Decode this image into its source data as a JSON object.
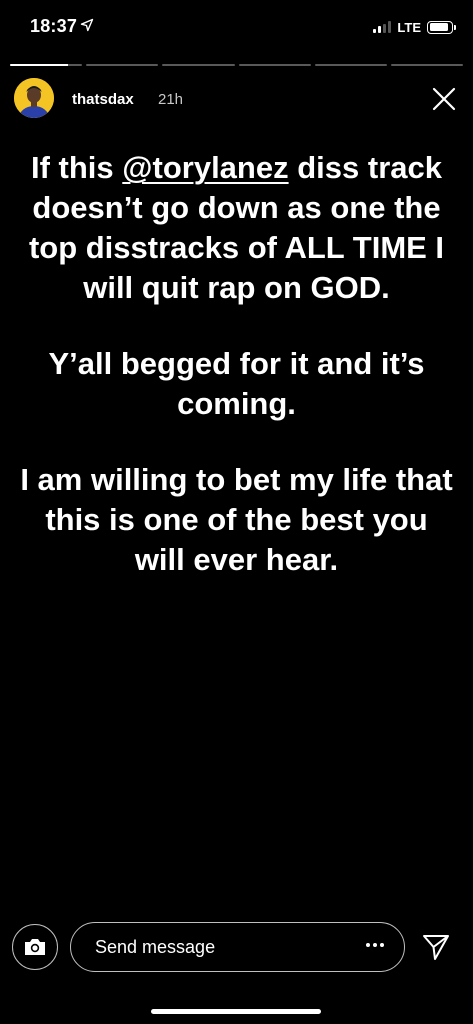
{
  "status_bar": {
    "time": "18:37",
    "network": "LTE",
    "signal_bars_active": 2,
    "signal_bars_total": 4,
    "battery_level": 0.9
  },
  "story": {
    "segments_total": 6,
    "current_segment": 1,
    "current_segment_progress": 0.8,
    "username": "thatsdax",
    "timestamp": "21h",
    "text": {
      "p1_before": "If this ",
      "p1_mention": "@torylanez",
      "p1_after": " diss track doesn’t go down as one the top disstracks of ALL TIME I will quit rap on GOD.",
      "p2": "Y’all begged for it and it’s coming.",
      "p3": "I am willing to bet my life that this is one of the best you will ever hear."
    }
  },
  "footer": {
    "message_placeholder": "Send message"
  },
  "icons": {
    "location": "location-arrow-icon",
    "close": "close-icon",
    "camera": "camera-icon",
    "more": "more-dots-icon",
    "send": "paper-plane-icon"
  },
  "colors": {
    "background": "#000000",
    "text": "#ffffff",
    "avatar_bg": "#f3c423",
    "timestamp": "#c8c8c8"
  }
}
